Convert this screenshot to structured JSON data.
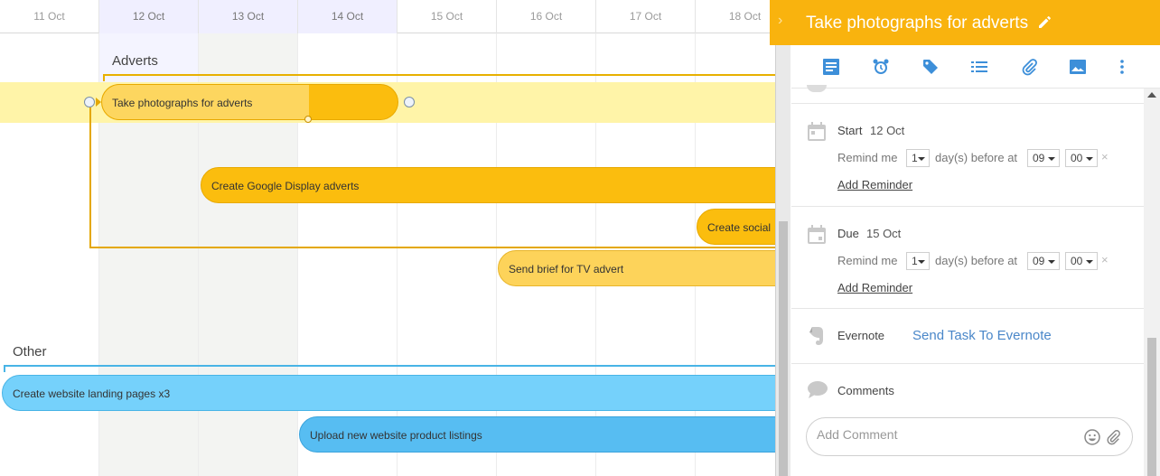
{
  "timeline": {
    "days": [
      "11 Oct",
      "12 Oct",
      "13 Oct",
      "14 Oct",
      "15 Oct",
      "16 Oct",
      "17 Oct",
      "18 Oct"
    ]
  },
  "groups": {
    "adverts": "Adverts",
    "other": "Other"
  },
  "tasks": {
    "photos": "Take photographs for adverts",
    "google": "Create Google Display adverts",
    "social": "Create social",
    "tv": "Send brief for TV advert",
    "landing": "Create website landing pages x3",
    "upload": "Upload new website product listings"
  },
  "panel": {
    "title": "Take photographs for adverts",
    "start": {
      "label": "Start",
      "value": "12 Oct"
    },
    "due": {
      "label": "Due",
      "value": "15 Oct"
    },
    "reminder": {
      "remind_me": "Remind me",
      "count": "1",
      "days_before": "day(s)  before at",
      "hour": "09",
      "minute": "00",
      "add": "Add Reminder"
    },
    "evernote": {
      "label": "Evernote",
      "link": "Send Task To Evernote"
    },
    "comments": {
      "label": "Comments",
      "placeholder": "Add Comment"
    }
  },
  "colors": {
    "accent": "#f9b30e",
    "task_orange": "#fbbd0e",
    "task_blue": "#75d1fb",
    "link": "#4a87c9"
  },
  "icons": [
    "notes-icon",
    "alarm-icon",
    "tag-icon",
    "checklist-icon",
    "paperclip-icon",
    "image-icon",
    "more-icon",
    "calendar-icon",
    "evernote-icon",
    "comment-icon",
    "emoji-icon",
    "pencil-icon"
  ]
}
